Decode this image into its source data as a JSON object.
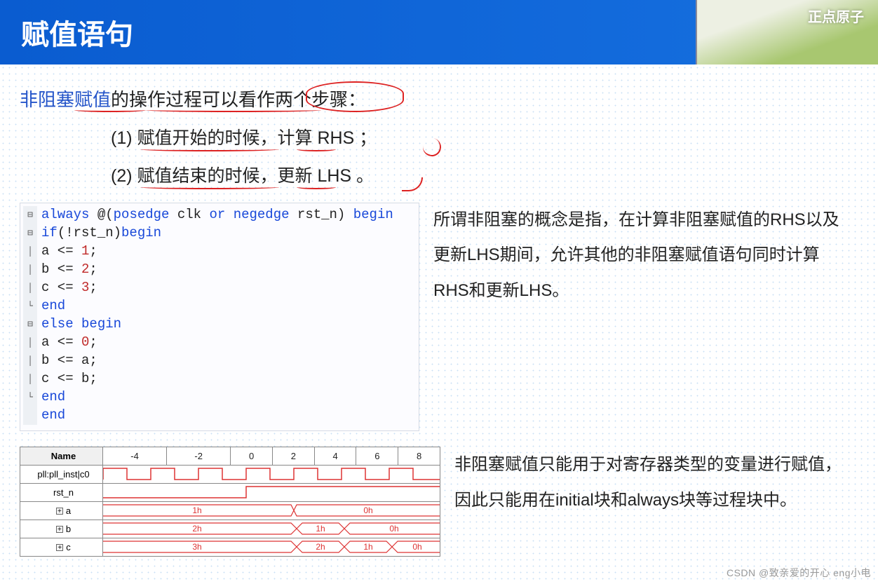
{
  "header": {
    "title": "赋值语句",
    "corner_text": "正点原子"
  },
  "intro": {
    "prefix": "非阻塞赋值",
    "rest": "的操作过程可以看作两个步骤：",
    "step1": "(1) 赋值开始的时候，计算 RHS ；",
    "step2": "(2) 赋值结束的时候，更新 LHS 。"
  },
  "code": {
    "l1_a": "always",
    "l1_b": " @(",
    "l1_c": "posedge",
    "l1_d": " clk ",
    "l1_e": "or",
    "l1_f": " negedge",
    "l1_g": " rst_n) ",
    "l1_h": "begin",
    "l2_a": "    if",
    "l2_b": "(!rst_n)",
    "l2_c": "begin",
    "l3": "        a <= ",
    "l3v": "1",
    "l3e": ";",
    "l4": "        b <= ",
    "l4v": "2",
    "l4e": ";",
    "l5": "        c <= ",
    "l5v": "3",
    "l5e": ";",
    "l6": "    end",
    "l7_a": "    else",
    "l7_b": " begin",
    "l8": "        a <= ",
    "l8v": "0",
    "l8e": ";",
    "l9": "        b <= a;",
    "l10": "        c <= b;",
    "l11": "    end",
    "l12": "end"
  },
  "para1": "所谓非阻塞的概念是指，在计算非阻塞赋值的RHS以及更新LHS期间，允许其他的非阻塞赋值语句同时计算RHS和更新LHS。",
  "para2": "非阻塞赋值只能用于对寄存器类型的变量进行赋值，因此只能用在initial块和always块等过程块中。",
  "wave": {
    "name_header": "Name",
    "ticks": [
      "-4",
      "-2",
      "0",
      "2",
      "4",
      "6",
      "8"
    ],
    "rows": [
      {
        "name": "pll:pll_inst|c0",
        "vals": []
      },
      {
        "name": "rst_n",
        "vals": []
      },
      {
        "name": "a",
        "vals": [
          "1h",
          "0h"
        ]
      },
      {
        "name": "b",
        "vals": [
          "2h",
          "1h",
          "0h"
        ]
      },
      {
        "name": "c",
        "vals": [
          "3h",
          "2h",
          "1h",
          "0h"
        ]
      }
    ]
  },
  "watermark": "CSDN @致亲爱的开心 eng小电"
}
